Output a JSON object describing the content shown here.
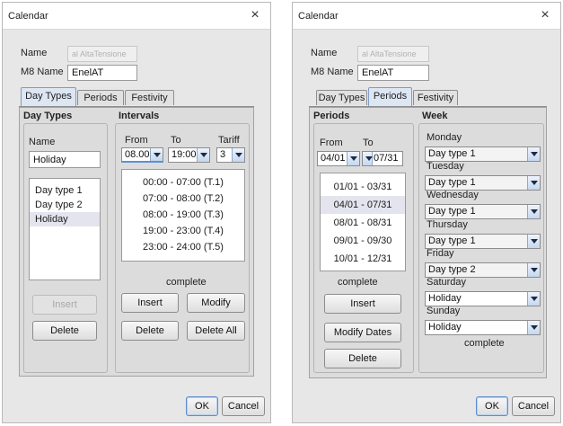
{
  "left_dialog": {
    "title": "Calendar",
    "close_glyph": "×",
    "name_label": "Name",
    "name_value": "al AltaTensione",
    "m8name_label": "M8 Name",
    "m8name_value": "EnelAT",
    "tabs": [
      "Day Types",
      "Periods",
      "Festivity"
    ],
    "active_tab": "Day Types",
    "daytypes": {
      "header": "Day Types",
      "name_label": "Name",
      "name_value": "Holiday",
      "items": [
        "Day type 1",
        "Day type 2",
        "Holiday"
      ],
      "selected": "Holiday",
      "insert": "Insert",
      "delete": "Delete"
    },
    "intervals": {
      "header": "Intervals",
      "from_label": "From",
      "to_label": "To",
      "tariff_label": "Tariff",
      "from_value": "08.00",
      "to_value": "19:00",
      "tariff_value": "3",
      "items": [
        "00:00 - 07:00  (T.1)",
        "07:00 - 08:00  (T.2)",
        "08:00 - 19:00  (T.3)",
        "19:00 - 23:00  (T.4)",
        "23:00 - 24:00  (T.5)"
      ],
      "status": "complete",
      "insert": "Insert",
      "modify": "Modify",
      "delete": "Delete",
      "delete_all": "Delete All"
    },
    "ok": "OK",
    "cancel": "Cancel"
  },
  "right_dialog": {
    "title": "Calendar",
    "close_glyph": "×",
    "name_label": "Name",
    "name_value": "al AltaTensione",
    "m8name_label": "M8 Name",
    "m8name_value": "EnelAT",
    "tabs": [
      "Day Types",
      "Periods",
      "Festivity"
    ],
    "active_tab": "Periods",
    "periods": {
      "header": "Periods",
      "from_label": "From",
      "to_label": "To",
      "from_value": "04/01",
      "to_value": "07/31",
      "items": [
        "01/01 - 03/31",
        "04/01 - 07/31",
        "08/01 - 08/31",
        "09/01 - 09/30",
        "10/01 - 12/31"
      ],
      "selected": "04/01 - 07/31",
      "status": "complete",
      "insert": "Insert",
      "modify_dates": "Modify Dates",
      "delete": "Delete"
    },
    "week": {
      "header": "Week",
      "days": [
        {
          "label": "Monday",
          "value": "Day type 1"
        },
        {
          "label": "Tuesday",
          "value": "Day type 1"
        },
        {
          "label": "Wednesday",
          "value": "Day type 1"
        },
        {
          "label": "Thursday",
          "value": "Day type 1"
        },
        {
          "label": "Friday",
          "value": "Day type 2"
        },
        {
          "label": "Saturday",
          "value": "Holiday"
        },
        {
          "label": "Sunday",
          "value": "Holiday"
        }
      ],
      "status": "complete"
    },
    "ok": "OK",
    "cancel": "Cancel"
  }
}
